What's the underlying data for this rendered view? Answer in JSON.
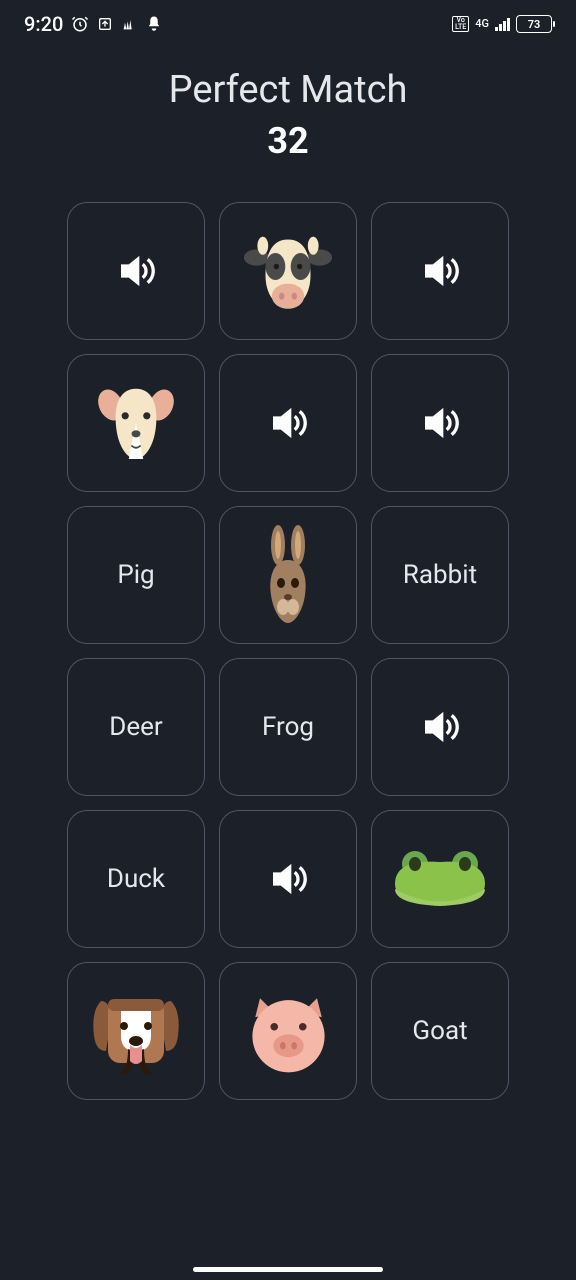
{
  "status": {
    "time": "9:20",
    "network_label": "4G",
    "volte_label": "Vo\nLTE",
    "battery": "73"
  },
  "header": {
    "title": "Perfect Match",
    "score": "32"
  },
  "cards": [
    {
      "type": "sound",
      "name": "sound"
    },
    {
      "type": "image",
      "name": "cow"
    },
    {
      "type": "sound",
      "name": "sound"
    },
    {
      "type": "image",
      "name": "sheep"
    },
    {
      "type": "sound",
      "name": "sound"
    },
    {
      "type": "sound",
      "name": "sound"
    },
    {
      "type": "text",
      "label": "Pig"
    },
    {
      "type": "image",
      "name": "rabbit"
    },
    {
      "type": "text",
      "label": "Rabbit"
    },
    {
      "type": "text",
      "label": "Deer"
    },
    {
      "type": "text",
      "label": "Frog"
    },
    {
      "type": "sound",
      "name": "sound"
    },
    {
      "type": "text",
      "label": "Duck"
    },
    {
      "type": "sound",
      "name": "sound"
    },
    {
      "type": "image",
      "name": "frog"
    },
    {
      "type": "image",
      "name": "dog"
    },
    {
      "type": "image",
      "name": "pig"
    },
    {
      "type": "text",
      "label": "Goat"
    }
  ]
}
